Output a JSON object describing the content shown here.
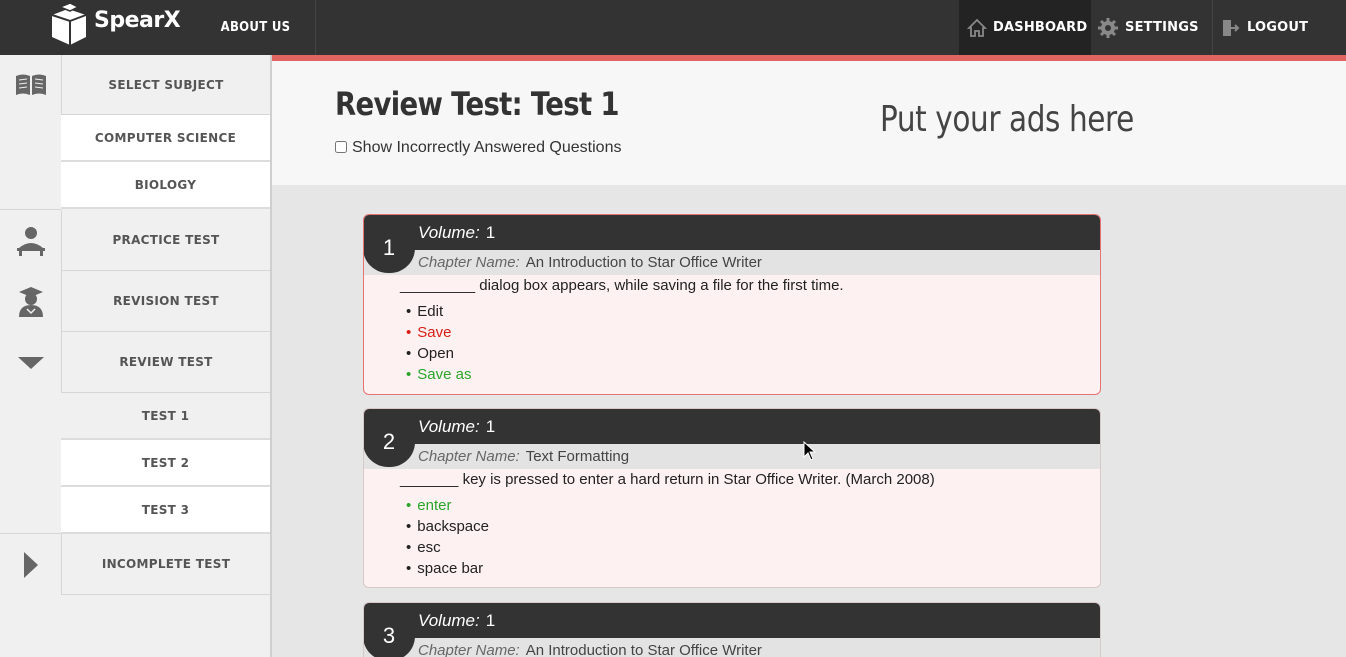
{
  "topbar": {
    "logo_text": "SpearX",
    "about": "ABOUT US",
    "dashboard": "DASHBOARD",
    "settings": "SETTINGS",
    "logout": "LOGOUT"
  },
  "sidebar": {
    "select_subject": "SELECT SUBJECT",
    "subjects": [
      "COMPUTER SCIENCE",
      "BIOLOGY"
    ],
    "practice_test": "PRACTICE TEST",
    "revision_test": "REVISION TEST",
    "review_test": "REVIEW TEST",
    "tests": [
      "TEST 1",
      "TEST 2",
      "TEST 3"
    ],
    "incomplete_test": "INCOMPLETE TEST"
  },
  "header": {
    "title": "Review Test: Test 1",
    "show_incorrect_label": "Show Incorrectly Answered Questions",
    "ads": "Put your ads here"
  },
  "questions": [
    {
      "number": "1",
      "volume_label": "Volume:",
      "volume": "1",
      "chapter_label": "Chapter Name:",
      "chapter": "An Introduction to Star Office Writer",
      "text": "_________ dialog box appears, while saving a file for the first time.",
      "options": [
        {
          "text": "Edit",
          "status": "normal"
        },
        {
          "text": "Save",
          "status": "wrong"
        },
        {
          "text": "Open",
          "status": "normal"
        },
        {
          "text": "Save as",
          "status": "correct"
        }
      ]
    },
    {
      "number": "2",
      "volume_label": "Volume:",
      "volume": "1",
      "chapter_label": "Chapter Name:",
      "chapter": "Text Formatting",
      "text": "_______ key is pressed to enter a hard return in Star Office Writer. (March 2008)",
      "options": [
        {
          "text": "enter",
          "status": "correct"
        },
        {
          "text": "backspace",
          "status": "normal"
        },
        {
          "text": "esc",
          "status": "normal"
        },
        {
          "text": "space bar",
          "status": "normal"
        }
      ]
    },
    {
      "number": "3",
      "volume_label": "Volume:",
      "volume": "1",
      "chapter_label": "Chapter Name:",
      "chapter": "An Introduction to Star Office Writer"
    }
  ],
  "colors": {
    "topbar": "#333333",
    "accent_red": "#e0645f",
    "wrong": "#d91e18",
    "correct": "#2aa52a"
  },
  "icons": {
    "sidebar": [
      "book-icon",
      "teacher-icon",
      "student-icon",
      "caret-down-icon",
      "caret-right-icon"
    ],
    "nav": [
      "home-icon",
      "gear-icon",
      "logout-icon"
    ]
  }
}
